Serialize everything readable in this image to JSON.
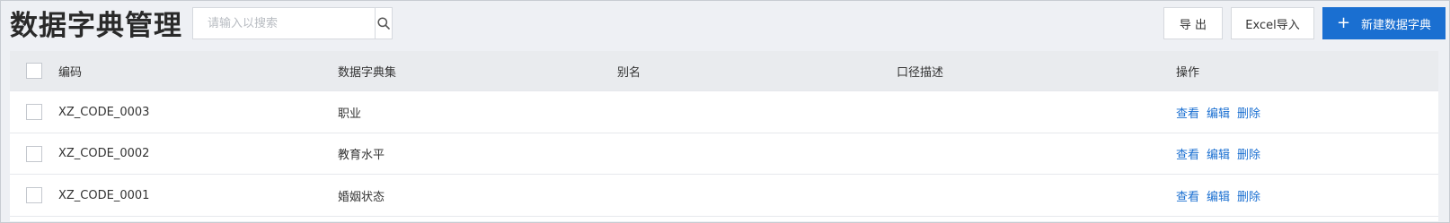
{
  "page": {
    "title": "数据字典管理"
  },
  "search": {
    "placeholder": "请输入以搜索",
    "value": ""
  },
  "toolbar": {
    "export_label": "导 出",
    "excel_import_label": "Excel导入",
    "new_label": "新建数据字典"
  },
  "table": {
    "columns": [
      "编码",
      "数据字典集",
      "别名",
      "口径描述",
      "操作"
    ],
    "rows": [
      {
        "code": "XZ_CODE_0003",
        "set": "职业",
        "alias": "",
        "desc": ""
      },
      {
        "code": "XZ_CODE_0002",
        "set": "教育水平",
        "alias": "",
        "desc": ""
      },
      {
        "code": "XZ_CODE_0001",
        "set": "婚姻状态",
        "alias": "",
        "desc": ""
      }
    ],
    "actions": {
      "view": "查看",
      "edit": "编辑",
      "delete": "删除"
    }
  },
  "colors": {
    "accent": "#1a6fd1",
    "header_bg": "#e9ebee",
    "page_bg": "#eef0f4"
  }
}
